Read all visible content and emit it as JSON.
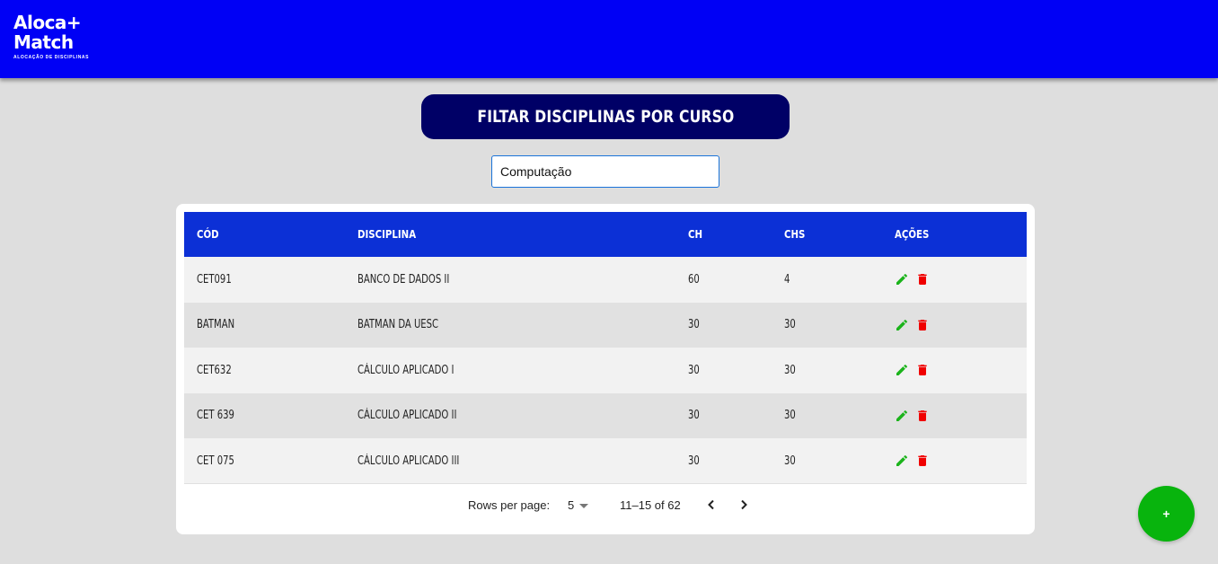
{
  "brand": {
    "line1": "Aloca+",
    "line2": "Match",
    "tagline": "ALOCAÇÃO DE DISCIPLINAS",
    "color": "#0000f5"
  },
  "filter": {
    "title": "FILTAR DISCIPLINAS POR CURSO",
    "course_value": "Computação"
  },
  "table": {
    "headers": [
      "CÓD",
      "DISCIPLINA",
      "CH",
      "CHS",
      "AÇÕES"
    ],
    "rows": [
      {
        "cod": "CET091",
        "disciplina": "BANCO DE DADOS II",
        "ch": "60",
        "chs": "4"
      },
      {
        "cod": "BATMAN",
        "disciplina": "BATMAN DA UESC",
        "ch": "30",
        "chs": "30"
      },
      {
        "cod": "CET632",
        "disciplina": "CÁLCULO APLICADO I",
        "ch": "30",
        "chs": "30"
      },
      {
        "cod": "CET 639",
        "disciplina": "CÁLCULO APLICADO II",
        "ch": "30",
        "chs": "30"
      },
      {
        "cod": "CET 075",
        "disciplina": "CÁLCULO APLICADO III",
        "ch": "30",
        "chs": "30"
      }
    ],
    "header_color": "#0c30d6"
  },
  "pagination": {
    "rows_per_page_label": "Rows per page:",
    "rows_per_page_value": "5",
    "range": "11–15 of 62"
  },
  "fab": {
    "label": "+",
    "color": "#08b40d"
  },
  "icons": {
    "edit": "pencil-icon",
    "delete": "trash-icon",
    "prev": "chevron-left-icon",
    "next": "chevron-right-icon",
    "dropdown": "caret-down-icon"
  },
  "colors": {
    "edit": "#1bb31b",
    "delete": "#f00000",
    "title_bg": "#000066"
  }
}
